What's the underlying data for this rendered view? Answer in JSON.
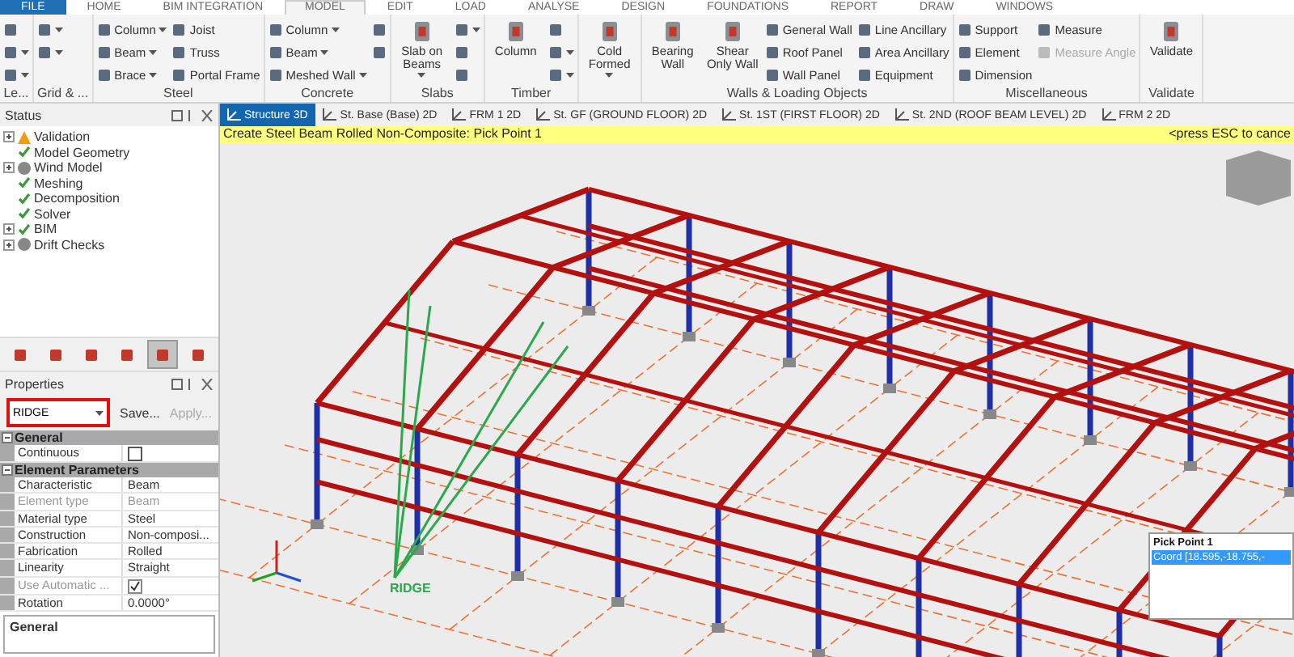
{
  "menu_tabs": [
    {
      "label": "FILE",
      "selected": false,
      "kind": "file"
    },
    {
      "label": "HOME",
      "selected": false,
      "kind": "tab"
    },
    {
      "label": "BIM INTEGRATION",
      "selected": false,
      "kind": "tab"
    },
    {
      "label": "MODEL",
      "selected": true,
      "kind": "tab"
    },
    {
      "label": "EDIT",
      "selected": false,
      "kind": "tab"
    },
    {
      "label": "LOAD",
      "selected": false,
      "kind": "tab"
    },
    {
      "label": "ANALYSE",
      "selected": false,
      "kind": "tab"
    },
    {
      "label": "DESIGN",
      "selected": false,
      "kind": "tab"
    },
    {
      "label": "FOUNDATIONS",
      "selected": false,
      "kind": "tab"
    },
    {
      "label": "REPORT",
      "selected": false,
      "kind": "tab"
    },
    {
      "label": "DRAW",
      "selected": false,
      "kind": "tab"
    },
    {
      "label": "WINDOWS",
      "selected": false,
      "kind": "tab"
    }
  ],
  "ribbon": [
    {
      "label": "Le...",
      "columns": [
        {
          "kind": "stack",
          "items": [
            {
              "dropdown": false
            },
            {
              "dropdown": true
            },
            {
              "dropdown": true
            }
          ]
        }
      ]
    },
    {
      "label": "Grid & ...",
      "columns": [
        {
          "kind": "stack",
          "items": [
            {
              "dropdown": true
            },
            {
              "dropdown": true
            }
          ]
        }
      ]
    },
    {
      "label": "Steel",
      "columns": [
        {
          "kind": "stack",
          "items": [
            {
              "label": "Column",
              "dropdown": true
            },
            {
              "label": "Beam",
              "dropdown": true
            },
            {
              "label": "Brace",
              "dropdown": true
            }
          ]
        },
        {
          "kind": "stack",
          "items": [
            {
              "label": "Joist",
              "dropdown": false
            },
            {
              "label": "Truss",
              "dropdown": false
            },
            {
              "label": "Portal Frame",
              "dropdown": false
            }
          ]
        }
      ]
    },
    {
      "label": "Concrete",
      "columns": [
        {
          "kind": "stack",
          "items": [
            {
              "label": "Column",
              "dropdown": true
            },
            {
              "label": "Beam",
              "dropdown": true
            },
            {
              "label": "Meshed Wall",
              "dropdown": true
            }
          ]
        },
        {
          "kind": "stack",
          "items": [
            {
              "dropdown": false
            },
            {
              "dropdown": false
            }
          ]
        }
      ]
    },
    {
      "label": "Slabs",
      "columns": [
        {
          "kind": "large",
          "label": "Slab on Beams",
          "dropdown": true
        },
        {
          "kind": "stack",
          "items": [
            {
              "dropdown": true
            },
            {
              "dropdown": false
            },
            {
              "dropdown": false
            }
          ]
        }
      ]
    },
    {
      "label": "Timber",
      "columns": [
        {
          "kind": "large",
          "label": "Column",
          "dropdown": false
        },
        {
          "kind": "stack",
          "items": [
            {
              "dropdown": false
            },
            {
              "dropdown": true
            },
            {
              "dropdown": true
            }
          ]
        }
      ]
    },
    {
      "columns": [
        {
          "kind": "large",
          "label": "Cold Formed",
          "dropdown": true
        }
      ]
    },
    {
      "label": "Walls & Loading Objects",
      "columns": [
        {
          "kind": "large",
          "label": "Bearing Wall",
          "dropdown": false
        },
        {
          "kind": "large",
          "label": "Shear Only Wall",
          "dropdown": false
        },
        {
          "kind": "stack",
          "items": [
            {
              "label": "General Wall",
              "dropdown": false
            },
            {
              "label": "Roof Panel",
              "dropdown": false
            },
            {
              "label": "Wall Panel",
              "dropdown": false
            }
          ]
        },
        {
          "kind": "stack",
          "items": [
            {
              "label": "Line Ancillary",
              "dropdown": false
            },
            {
              "label": "Area Ancillary",
              "dropdown": false
            },
            {
              "label": "Equipment",
              "dropdown": false
            }
          ]
        }
      ]
    },
    {
      "label": "Miscellaneous",
      "columns": [
        {
          "kind": "stack",
          "items": [
            {
              "label": "Support",
              "dropdown": false
            },
            {
              "label": "Element",
              "dropdown": false
            },
            {
              "label": "Dimension",
              "dropdown": false
            }
          ]
        },
        {
          "kind": "stack",
          "items": [
            {
              "label": "Measure",
              "dropdown": false,
              "disabled": false
            },
            {
              "label": "Measure Angle",
              "dropdown": false,
              "disabled": true
            }
          ]
        }
      ]
    },
    {
      "label": "Validate",
      "columns": [
        {
          "kind": "large",
          "label": "Validate",
          "dropdown": false
        }
      ]
    }
  ],
  "status_panel": {
    "title": "Status",
    "items": [
      {
        "label": "Validation",
        "kind": "warning",
        "expander": true
      },
      {
        "label": "Model Geometry",
        "kind": "ok",
        "expander": false
      },
      {
        "label": "Wind Model",
        "kind": "unknown",
        "expander": true
      },
      {
        "label": "Meshing",
        "kind": "ok",
        "expander": false
      },
      {
        "label": "Decomposition",
        "kind": "ok",
        "expander": false
      },
      {
        "label": "Solver",
        "kind": "ok",
        "expander": false
      },
      {
        "label": "BIM",
        "kind": "ok",
        "expander": true
      },
      {
        "label": "Drift Checks",
        "kind": "unknown",
        "expander": true
      }
    ]
  },
  "panel_toolbar": [
    {
      "selected": false
    },
    {
      "selected": false
    },
    {
      "selected": false
    },
    {
      "selected": false
    },
    {
      "selected": true
    },
    {
      "selected": false
    }
  ],
  "properties": {
    "title": "Properties",
    "selector": "RIDGE",
    "buttons": [
      {
        "label": "Save...",
        "disabled": false
      },
      {
        "label": "Apply...",
        "disabled": true
      }
    ],
    "sections": [
      {
        "title": "General",
        "rows": [
          {
            "label": "Continuous",
            "kind": "checkbox",
            "checked": false,
            "disabled": false
          }
        ]
      },
      {
        "title": "Element Parameters",
        "rows": [
          {
            "label": "Characteristic",
            "kind": "text",
            "value": "Beam",
            "disabled": false
          },
          {
            "label": "Element type",
            "kind": "text",
            "value": "Beam",
            "disabled": true
          },
          {
            "label": "Material type",
            "kind": "text",
            "value": "Steel",
            "disabled": false
          },
          {
            "label": "Construction",
            "kind": "text",
            "value": "Non-composi...",
            "disabled": false
          },
          {
            "label": "Fabrication",
            "kind": "text",
            "value": "Rolled",
            "disabled": false
          },
          {
            "label": "Linearity",
            "kind": "text",
            "value": "Straight",
            "disabled": false
          },
          {
            "label": "Use Automatic ...",
            "kind": "checkbox",
            "checked": true,
            "disabled": true
          },
          {
            "label": "Rotation",
            "kind": "text",
            "value": "0.0000°",
            "disabled": false
          }
        ]
      }
    ],
    "footer": "General"
  },
  "doc_tabs": [
    {
      "label": "Structure 3D",
      "selected": true
    },
    {
      "label": "St. Base (Base) 2D",
      "selected": false
    },
    {
      "label": "FRM 1 2D",
      "selected": false
    },
    {
      "label": "St. GF (GROUND FLOOR) 2D",
      "selected": false
    },
    {
      "label": "St. 1ST (FIRST FLOOR) 2D",
      "selected": false
    },
    {
      "label": "St. 2ND (ROOF BEAM LEVEL) 2D",
      "selected": false
    },
    {
      "label": "FRM 2 2D",
      "selected": false
    }
  ],
  "prompt": {
    "text": "Create Steel Beam Rolled Non-Composite: Pick Point 1",
    "hint": "<press ESC to cance"
  },
  "viewport": {
    "annotation": "RIDGE"
  },
  "pick_popup": {
    "title": "Pick Point 1",
    "items": [
      {
        "label": "Coord [18.595,-18.755,-",
        "selected": true
      }
    ]
  }
}
